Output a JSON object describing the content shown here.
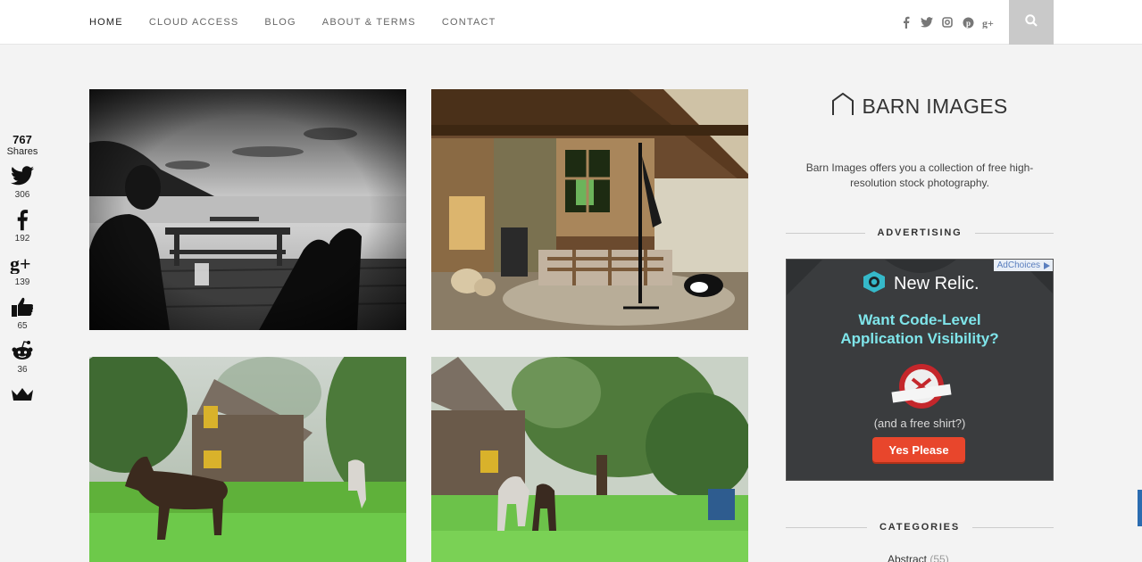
{
  "nav": {
    "items": [
      {
        "label": "HOME",
        "active": true
      },
      {
        "label": "CLOUD ACCESS",
        "active": false
      },
      {
        "label": "BLOG",
        "active": false
      },
      {
        "label": "ABOUT & TERMS",
        "active": false
      },
      {
        "label": "CONTACT",
        "active": false
      }
    ],
    "social_icons": [
      "facebook-icon",
      "twitter-icon",
      "instagram-icon",
      "pinterest-icon",
      "google-plus-icon"
    ],
    "search_icon": "search-icon"
  },
  "share_bar": {
    "total": "767",
    "label": "Shares",
    "items": [
      {
        "icon": "twitter-icon",
        "count": "306"
      },
      {
        "icon": "facebook-icon",
        "count": "192"
      },
      {
        "icon": "google-plus-icon",
        "count": "139"
      },
      {
        "icon": "like-icon",
        "count": "65"
      },
      {
        "icon": "reddit-icon",
        "count": "36"
      },
      {
        "icon": "crown-icon",
        "count": ""
      }
    ]
  },
  "photos": [
    {
      "name": "beach-picnic-photo"
    },
    {
      "name": "attic-room-photo"
    },
    {
      "name": "horse-barn-photo"
    },
    {
      "name": "horses-orchard-photo"
    }
  ],
  "sidebar": {
    "brand_title": "BARN IMAGES",
    "brand_desc": "Barn Images offers you a collection of free high-resolution stock photography.",
    "advertising_heading": "ADVERTISING",
    "categories_heading": "CATEGORIES",
    "categories": [
      {
        "label": "Abstract",
        "count": "(55)"
      }
    ]
  },
  "ad": {
    "adchoices": "AdChoices",
    "brand": "New Relic.",
    "headline_line1": "Want Code-Level",
    "headline_line2": "Application Visibility?",
    "sub": "(and a free shirt?)",
    "cta": "Yes Please",
    "colors": {
      "headline": "#7fe5ea",
      "cta": "#e8462c",
      "background": "#2f3133"
    }
  }
}
